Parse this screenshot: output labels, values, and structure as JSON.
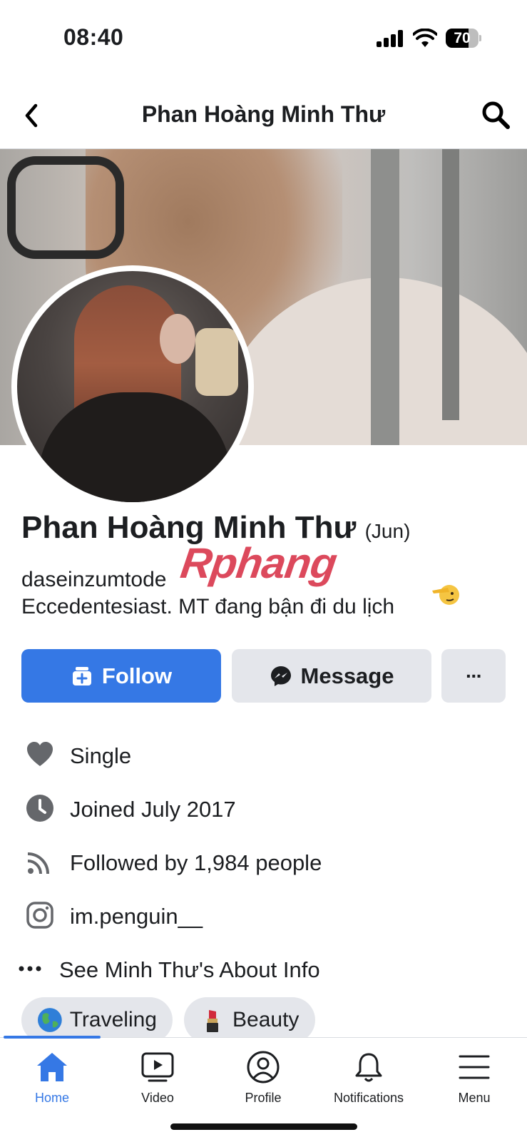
{
  "status_bar": {
    "time": "08:40",
    "battery": "70",
    "battery_level": 0.7
  },
  "header": {
    "title": "Phan Hoàng Minh Thư",
    "back_icon": "chevron-left-icon",
    "search_icon": "search-icon"
  },
  "profile": {
    "name": "Phan Hoàng Minh Thư",
    "nickname": "(Jun)",
    "bio_line1": "daseinzumtode",
    "bio_line2": "Eccedentesiast.  MT đang bận đi du lịch",
    "watermark": "Rphang"
  },
  "actions": {
    "follow_label": "Follow",
    "message_label": "Message",
    "more_label": "···"
  },
  "info": [
    {
      "icon": "heart-icon",
      "text": "Single"
    },
    {
      "icon": "clock-icon",
      "text": "Joined July 2017"
    },
    {
      "icon": "rss-icon",
      "text": "Followed by 1,984 people"
    },
    {
      "icon": "instagram-icon",
      "text": "im.penguin__"
    }
  ],
  "about": {
    "icon": "more-dots-icon",
    "text": "See Minh Thư's About Info"
  },
  "chips": [
    {
      "emoji": "globe-emoji",
      "label": "Traveling"
    },
    {
      "emoji": "lipstick-emoji",
      "label": "Beauty"
    }
  ],
  "nav": [
    {
      "label": "Home",
      "icon": "home-icon",
      "active": true
    },
    {
      "label": "Video",
      "icon": "video-icon",
      "active": false
    },
    {
      "label": "Profile",
      "icon": "profile-icon",
      "active": false
    },
    {
      "label": "Notifications",
      "icon": "bell-icon",
      "active": false
    },
    {
      "label": "Menu",
      "icon": "menu-icon",
      "active": false
    }
  ],
  "colors": {
    "accent": "#3578e5",
    "button_gray": "#e4e6eb",
    "icon_gray": "#65676b"
  }
}
